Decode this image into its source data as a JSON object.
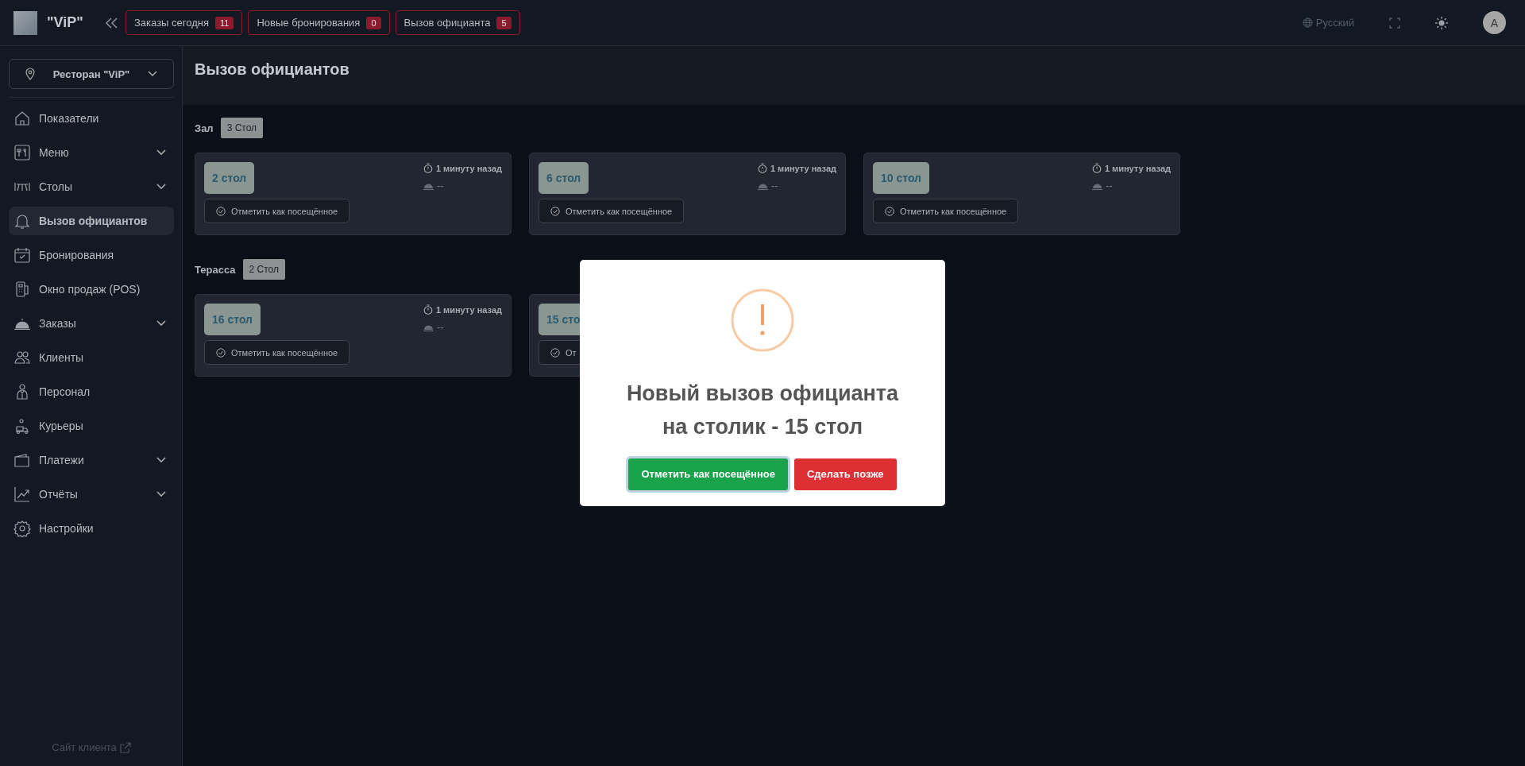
{
  "topbar": {
    "brand": "\"ViP\"",
    "badges": [
      {
        "label": "Заказы сегодня",
        "count": "11"
      },
      {
        "label": "Новые бронирования",
        "count": "0"
      },
      {
        "label": "Вызов официанта",
        "count": "5"
      }
    ],
    "language": "Русский",
    "avatar": "A"
  },
  "sidebar": {
    "restaurant": "Ресторан \"ViP\"",
    "items": [
      {
        "label": "Показатели",
        "selected": false,
        "expandable": false
      },
      {
        "label": "Меню",
        "selected": false,
        "expandable": true
      },
      {
        "label": "Столы",
        "selected": false,
        "expandable": true
      },
      {
        "label": "Вызов официантов",
        "selected": true,
        "expandable": false
      },
      {
        "label": "Бронирования",
        "selected": false,
        "expandable": false
      },
      {
        "label": "Окно продаж (POS)",
        "selected": false,
        "expandable": false
      },
      {
        "label": "Заказы",
        "selected": false,
        "expandable": true
      },
      {
        "label": "Клиенты",
        "selected": false,
        "expandable": false
      },
      {
        "label": "Персонал",
        "selected": false,
        "expandable": false
      },
      {
        "label": "Курьеры",
        "selected": false,
        "expandable": false
      },
      {
        "label": "Платежи",
        "selected": false,
        "expandable": true
      },
      {
        "label": "Отчёты",
        "selected": false,
        "expandable": true
      },
      {
        "label": "Настройки",
        "selected": false,
        "expandable": false
      }
    ],
    "footer_link": "Сайт клиента"
  },
  "page": {
    "title": "Вызов официантов",
    "sections": [
      {
        "name": "Зал",
        "count": "3 Стол",
        "tables": [
          {
            "label": "2 стол",
            "time": "1 минуту назад",
            "waiter": "--",
            "button": "Отметить как посещённое"
          },
          {
            "label": "6 стол",
            "time": "1 минуту назад",
            "waiter": "--",
            "button": "Отметить как посещённое"
          },
          {
            "label": "10 стол",
            "time": "1 минуту назад",
            "waiter": "--",
            "button": "Отметить как посещённое"
          }
        ]
      },
      {
        "name": "Терасса",
        "count": "2 Стол",
        "tables": [
          {
            "label": "16 стол",
            "time": "1 минуту назад",
            "waiter": "--",
            "button": "Отметить как посещённое"
          },
          {
            "label": "15 сто",
            "button": "От"
          }
        ]
      }
    ]
  },
  "modal": {
    "message": "Новый вызов официанта на столик - 15 стол",
    "buttons": [
      {
        "label": "Отметить как посещённое",
        "kind": "confirm"
      },
      {
        "label": "Сделать позже",
        "kind": "cancel"
      }
    ]
  }
}
